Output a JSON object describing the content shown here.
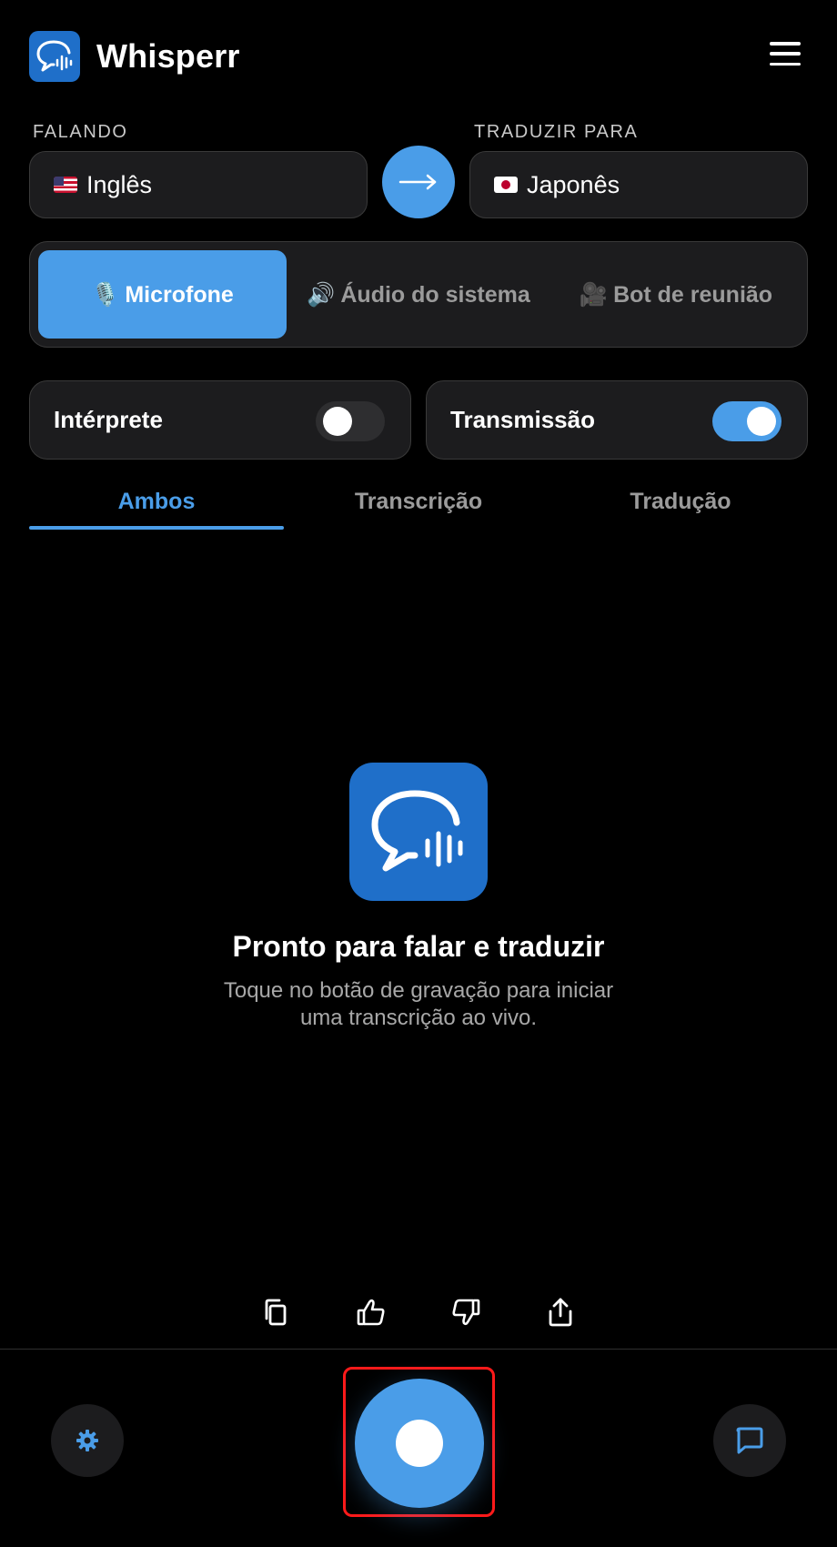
{
  "app": {
    "title": "Whisperr"
  },
  "languages": {
    "speaking_label": "FALANDO",
    "speaking_value": "Inglês",
    "translate_label": "TRADUZIR PARA",
    "translate_value": "Japonês",
    "speaking_flag": "us-flag",
    "translate_flag": "jp-flag"
  },
  "source": {
    "selected": "Microfone",
    "items": [
      {
        "icon": "🎙️",
        "label": "Microfone"
      },
      {
        "icon": "🔊",
        "label": "Áudio do sistema"
      },
      {
        "icon": "🎥",
        "label": "Bot de reunião"
      }
    ]
  },
  "toggles": [
    {
      "label": "Intérprete",
      "on": false
    },
    {
      "label": "Transmissão",
      "on": true
    }
  ],
  "tabs": [
    {
      "label": "Ambos",
      "active": true
    },
    {
      "label": "Transcrição",
      "active": false
    },
    {
      "label": "Tradução",
      "active": false
    }
  ],
  "empty_state": {
    "title": "Pronto para falar e traduzir",
    "subtitle": "Toque no botão de gravação para iniciar uma transcrição ao vivo."
  },
  "actions": [
    "copy-icon",
    "thumbs-up-icon",
    "thumbs-down-icon",
    "share-icon"
  ],
  "bottom_bar": {
    "left": "gear-icon",
    "center": "record-button",
    "right": "chat-icon"
  },
  "colors": {
    "accent": "#4a9de8",
    "brand": "#1f6fc9",
    "background": "#000000",
    "card": "#1c1c1e",
    "highlight": "#ff1a1a"
  }
}
